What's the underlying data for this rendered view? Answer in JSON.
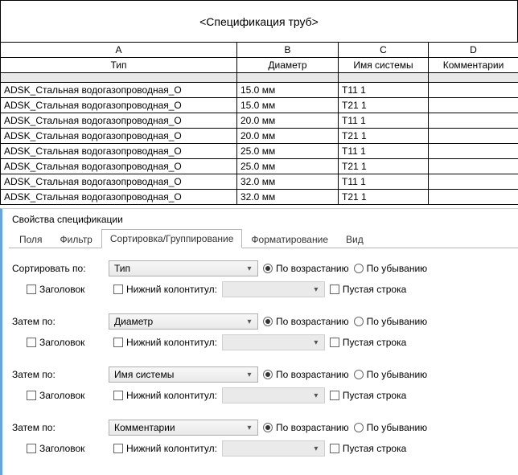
{
  "schedule": {
    "title": "<Спецификация труб>",
    "col_letters": [
      "A",
      "B",
      "C",
      "D"
    ],
    "headers": [
      "Тип",
      "Диаметр",
      "Имя системы",
      "Комментарии"
    ],
    "rows": [
      {
        "a": "ADSK_Стальная водогазопроводная_О",
        "b": "15.0 мм",
        "c": "Т11 1",
        "d": ""
      },
      {
        "a": "ADSK_Стальная водогазопроводная_О",
        "b": "15.0 мм",
        "c": "Т21 1",
        "d": ""
      },
      {
        "a": "ADSK_Стальная водогазопроводная_О",
        "b": "20.0 мм",
        "c": "Т11 1",
        "d": ""
      },
      {
        "a": "ADSK_Стальная водогазопроводная_О",
        "b": "20.0 мм",
        "c": "Т21 1",
        "d": ""
      },
      {
        "a": "ADSK_Стальная водогазопроводная_О",
        "b": "25.0 мм",
        "c": "Т11 1",
        "d": ""
      },
      {
        "a": "ADSK_Стальная водогазопроводная_О",
        "b": "25.0 мм",
        "c": "Т21 1",
        "d": ""
      },
      {
        "a": "ADSK_Стальная водогазопроводная_О",
        "b": "32.0 мм",
        "c": "Т11 1",
        "d": ""
      },
      {
        "a": "ADSK_Стальная водогазопроводная_О",
        "b": "32.0 мм",
        "c": "Т21 1",
        "d": ""
      }
    ]
  },
  "props": {
    "title": "Свойства спецификации",
    "tabs": [
      "Поля",
      "Фильтр",
      "Сортировка/Группирование",
      "Форматирование",
      "Вид"
    ],
    "labels": {
      "sort_by": "Сортировать по:",
      "then_by": "Затем по:",
      "header": "Заголовок",
      "footer": "Нижний колонтитул:",
      "asc": "По возрастанию",
      "desc": "По убыванию",
      "blank": "Пустая строка"
    },
    "sort_levels": [
      {
        "field": "Тип",
        "asc": true
      },
      {
        "field": "Диаметр",
        "asc": true
      },
      {
        "field": "Имя системы",
        "asc": true
      },
      {
        "field": "Комментарии",
        "asc": true
      }
    ]
  }
}
